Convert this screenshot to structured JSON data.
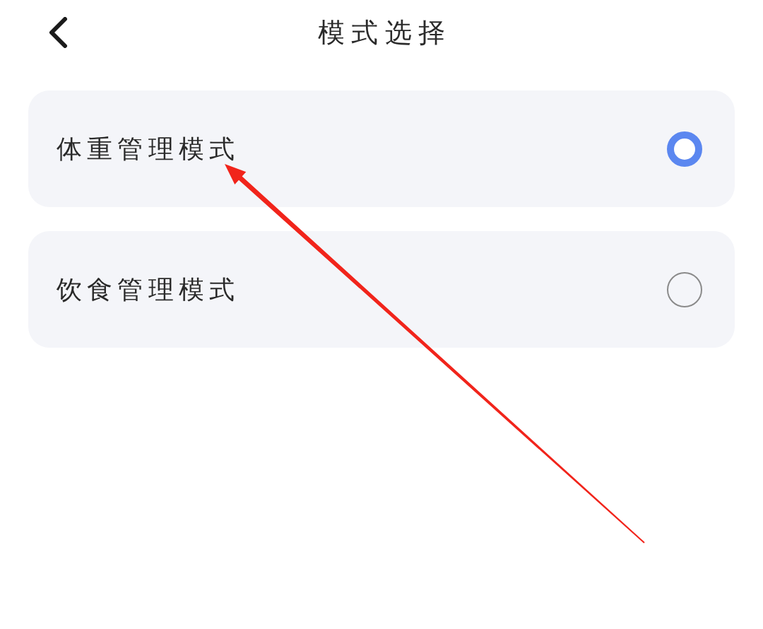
{
  "header": {
    "title": "模式选择"
  },
  "options": [
    {
      "label": "体重管理模式",
      "selected": true
    },
    {
      "label": "饮食管理模式",
      "selected": false
    }
  ],
  "annotations": [
    {
      "kind": "arrow"
    }
  ]
}
